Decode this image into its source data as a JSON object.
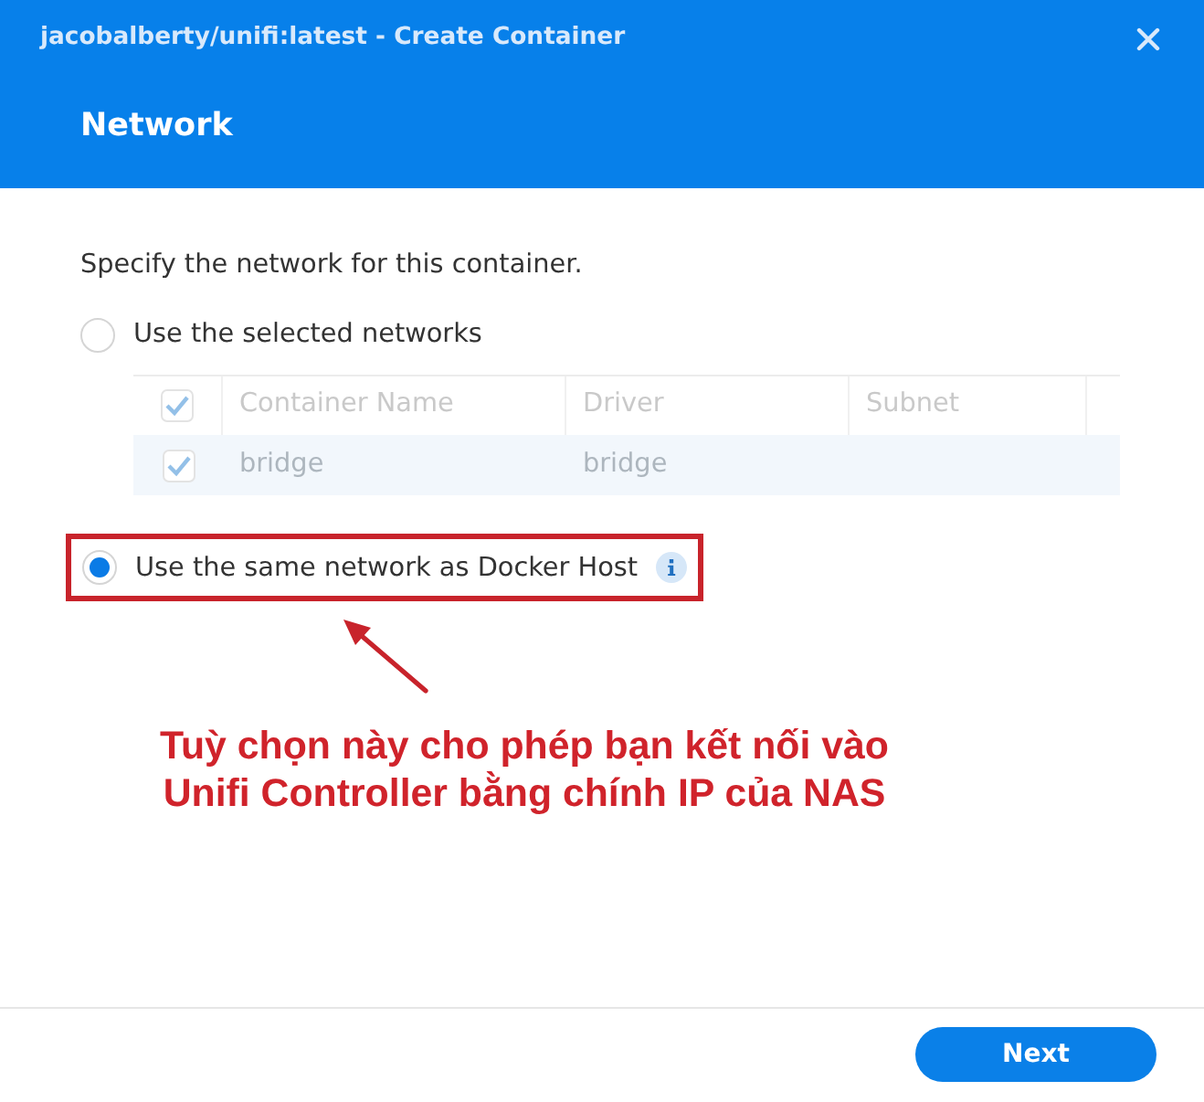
{
  "window": {
    "title": "jacobalberty/unifi:latest - Create Container"
  },
  "header": {
    "title": "Network"
  },
  "intro": "Specify the network for this container.",
  "options": [
    {
      "label": "Use the selected networks",
      "selected": false,
      "info_tip": false,
      "highlighted": false,
      "table": {
        "header_checked": true,
        "columns": [
          "Container Name",
          "Driver",
          "Subnet"
        ],
        "rows": [
          {
            "checked": true,
            "selected": true,
            "cells": [
              "bridge",
              "bridge"
            ]
          }
        ]
      }
    },
    {
      "label": "Use the same network as Docker Host",
      "selected": true,
      "info_tip": true,
      "highlighted": true
    }
  ],
  "annotation": {
    "lines": [
      "Tuỳ chọn này cho phép bạn kết nối vào",
      "Unifi Controller bằng chính IP của NAS"
    ]
  },
  "buttons": [
    {
      "label": "Next"
    }
  ]
}
